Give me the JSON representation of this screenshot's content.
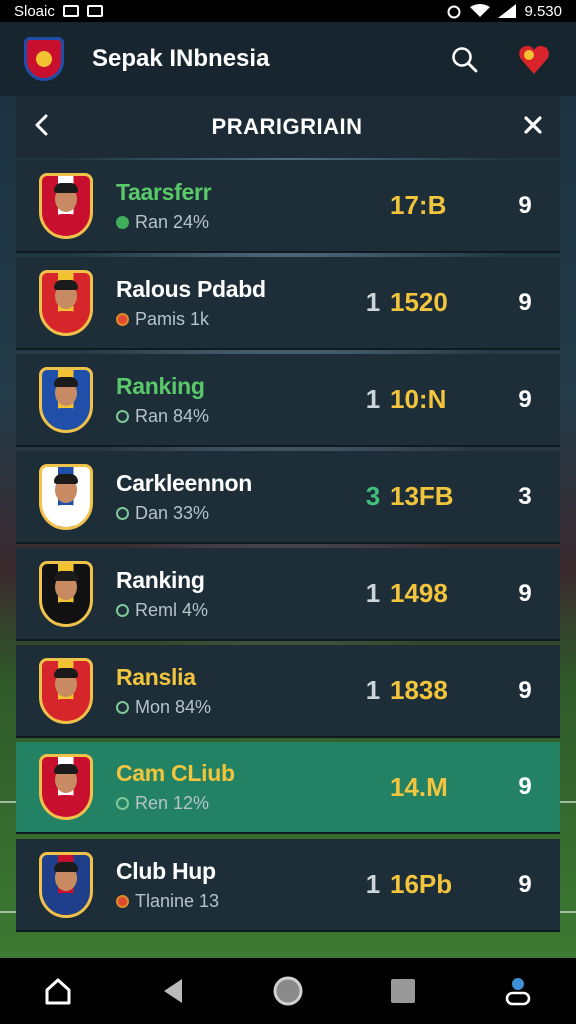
{
  "status_bar": {
    "left_text": "Sloaic",
    "time": "9.530"
  },
  "app": {
    "title": "Sepak INbnesia"
  },
  "subheader": {
    "title": "PRARIGRIAIN"
  },
  "rows": [
    {
      "name": "Taarsferr",
      "sub": "Ran 24%",
      "rank": "",
      "value": "17:B",
      "count": "9",
      "name_style": "green",
      "crest_colors": [
        "#c8102e",
        "#ffffff"
      ]
    },
    {
      "name": "Ralous Pdabd",
      "sub": "Pamis 1k",
      "rank": "1",
      "value": "1520",
      "count": "9",
      "name_style": "white",
      "crest_colors": [
        "#d6262c",
        "#f2c230"
      ]
    },
    {
      "name": "Ranking",
      "sub": "Ran 84%",
      "rank": "1",
      "value": "10:N",
      "count": "9",
      "name_style": "green",
      "crest_colors": [
        "#1f4fa8",
        "#f2c230"
      ]
    },
    {
      "name": "Carkleennon",
      "sub": "Dan 33%",
      "rank": "3",
      "value": "13FB",
      "count": "3",
      "name_style": "white",
      "crest_colors": [
        "#ffffff",
        "#1f4fa8"
      ]
    },
    {
      "name": "Ranking",
      "sub": "Reml 4%",
      "rank": "1",
      "value": "1498",
      "count": "9",
      "name_style": "white",
      "crest_colors": [
        "#111111",
        "#f2c230"
      ]
    },
    {
      "name": "Ranslia",
      "sub": "Mon 84%",
      "rank": "1",
      "value": "1838",
      "count": "9",
      "name_style": "yellow",
      "crest_colors": [
        "#d6262c",
        "#f2c230"
      ]
    },
    {
      "name": "Cam CLiub",
      "sub": "Ren 12%",
      "rank": "",
      "value": "14.M",
      "count": "9",
      "name_style": "yellow",
      "crest_colors": [
        "#c8102e",
        "#ffffff"
      ]
    },
    {
      "name": "Club Hup",
      "sub": "Tlanine 13",
      "rank": "1",
      "value": "16Pb",
      "count": "9",
      "name_style": "white",
      "crest_colors": [
        "#1f3f8a",
        "#c8102e"
      ]
    }
  ],
  "colors": {
    "accent_yellow": "#f2c53d",
    "highlight_row": "#238264",
    "rank_green": "#3fc07a"
  }
}
